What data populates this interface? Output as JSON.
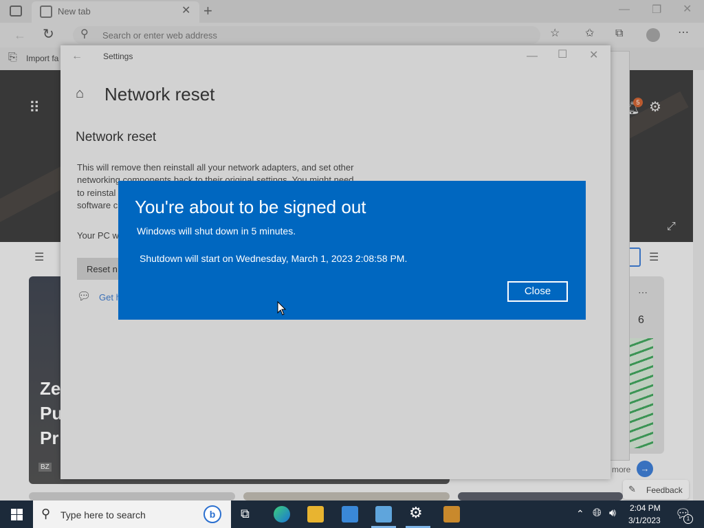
{
  "browser": {
    "tab_title": "New tab",
    "address_placeholder": "Search or enter web address",
    "favorites_label": "Import fa",
    "notification_count": "5",
    "feedback_label": "Feedback",
    "more_label": "more",
    "feed_number": "6",
    "card_headline": [
      "Ze",
      "Pu",
      "Pr"
    ],
    "card_source": "BZ"
  },
  "settings": {
    "window_title": "Settings",
    "page_title": "Network reset",
    "section_title": "Network reset",
    "desc_lines": [
      "This will remove then reinstall all your network adapters, and set other",
      "networking components back to their original settings. You might need",
      "to reinstal",
      "software c"
    ],
    "pc_line": "Your PC w",
    "reset_button": "Reset n",
    "help_link": "Get h"
  },
  "dialog": {
    "title": "You're about to be signed out",
    "line1": "Windows will shut down in 5 minutes.",
    "line2": "Shutdown will start on Wednesday, March 1, 2023 2:08:58 PM.",
    "close_label": "Close"
  },
  "taskbar": {
    "search_placeholder": "Type here to search",
    "time": "2:04 PM",
    "date": "3/1/2023",
    "notif_badge": "1"
  },
  "colors": {
    "dialog_bg": "#0067c0",
    "taskbar_bg": "#1c2a3a",
    "accent": "#0067c0"
  }
}
